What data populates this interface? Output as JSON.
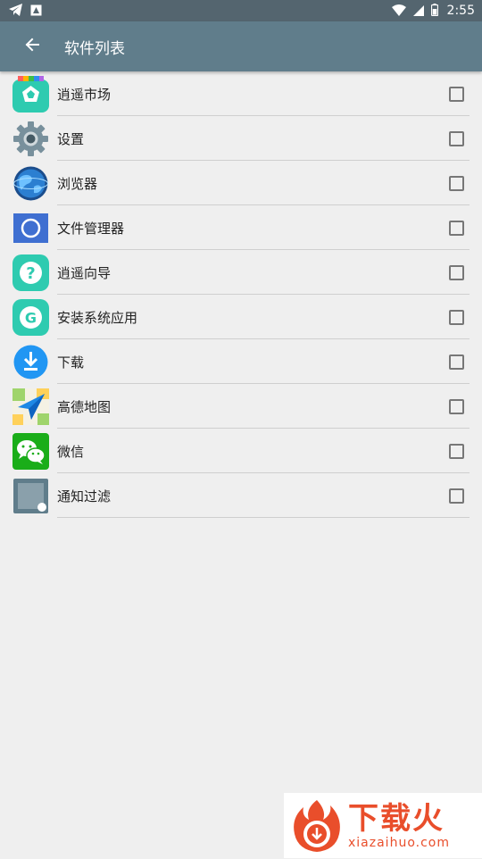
{
  "status_bar": {
    "time": "2:55",
    "icons": [
      "telegram-icon",
      "notification-box-icon",
      "wifi-icon",
      "signal-icon",
      "battery-icon"
    ]
  },
  "app_bar": {
    "title": "软件列表",
    "back_icon": "arrow-left-icon",
    "background": "#607d8b"
  },
  "apps": [
    {
      "label": "逍遥市场",
      "icon": "xiaoyao-market-icon",
      "checked": false
    },
    {
      "label": "设置",
      "icon": "settings-gear-icon",
      "checked": false
    },
    {
      "label": "浏览器",
      "icon": "browser-globe-icon",
      "checked": false
    },
    {
      "label": "文件管理器",
      "icon": "file-manager-icon",
      "checked": false
    },
    {
      "label": "逍遥向导",
      "icon": "help-question-icon",
      "checked": false
    },
    {
      "label": "安装系统应用",
      "icon": "install-g-icon",
      "checked": false
    },
    {
      "label": "下载",
      "icon": "download-icon",
      "checked": false
    },
    {
      "label": "高德地图",
      "icon": "amap-icon",
      "checked": false
    },
    {
      "label": "微信",
      "icon": "wechat-icon",
      "checked": false
    },
    {
      "label": "通知过滤",
      "icon": "notification-filter-icon",
      "checked": false
    }
  ],
  "watermark": {
    "brand": "下载火",
    "url": "xiazaihuo.com",
    "color": "#e94e2b"
  }
}
